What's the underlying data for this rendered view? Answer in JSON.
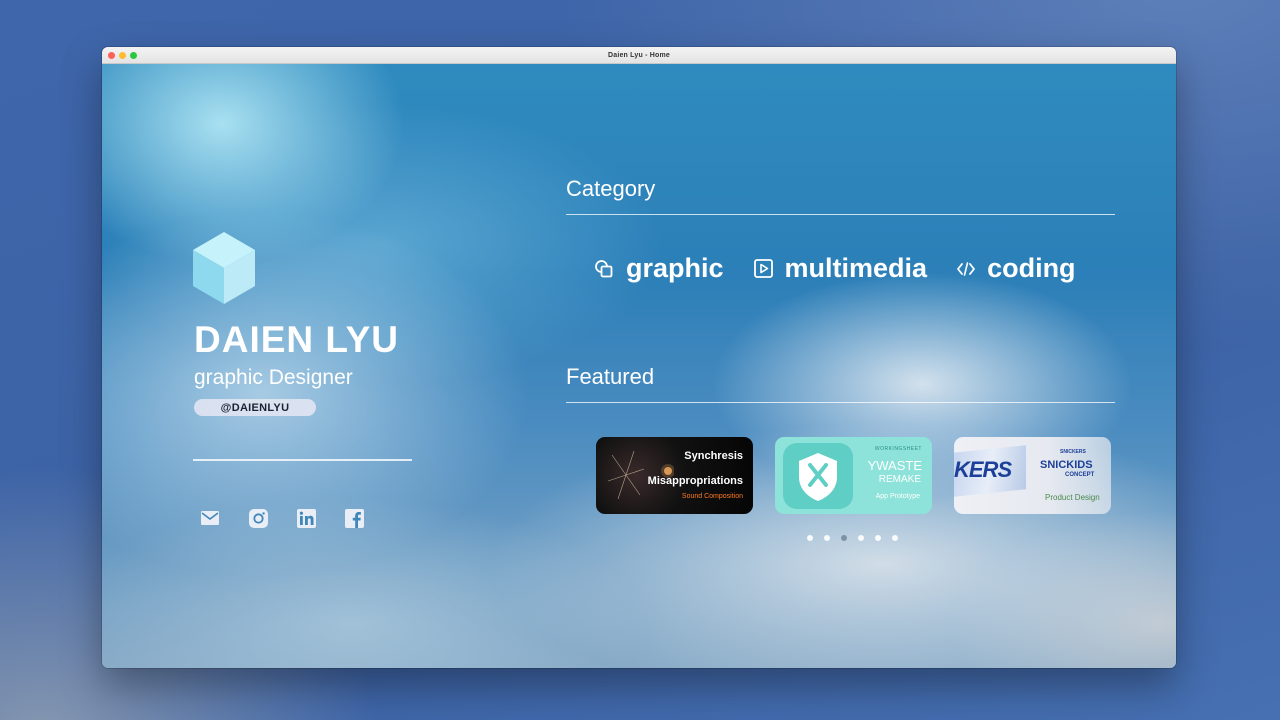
{
  "window": {
    "title": "Daien Lyu - Home"
  },
  "profile": {
    "name": "DAIEN LYU",
    "role": "graphic Designer",
    "handle": "@DAIENLYU"
  },
  "socials": [
    {
      "icon": "mail-icon"
    },
    {
      "icon": "instagram-icon"
    },
    {
      "icon": "linkedin-icon"
    },
    {
      "icon": "facebook-icon"
    }
  ],
  "category": {
    "title": "Category",
    "items": [
      {
        "label": "graphic",
        "icon": "shapes-icon"
      },
      {
        "label": "multimedia",
        "icon": "play-icon"
      },
      {
        "label": "coding",
        "icon": "code-icon"
      }
    ]
  },
  "featured": {
    "title": "Featured",
    "cards": [
      {
        "line1": "Synchresis",
        "line2": "Misappropriations",
        "subtitle": "Sound Composition",
        "accent": "#ff7a22"
      },
      {
        "tag": "WORKINGSHEET",
        "line1": "YWASTE",
        "line2": "REMAKE",
        "subtitle": "App Prototype",
        "accent": "#8de3d9"
      },
      {
        "brand": "KERS",
        "tag": "SNICKERS",
        "line1": "SNICKIDS",
        "line2": "CONCEPT",
        "subtitle": "Product Design",
        "accent": "#1c3f99"
      }
    ],
    "page_count": 6,
    "active_page": 3
  }
}
